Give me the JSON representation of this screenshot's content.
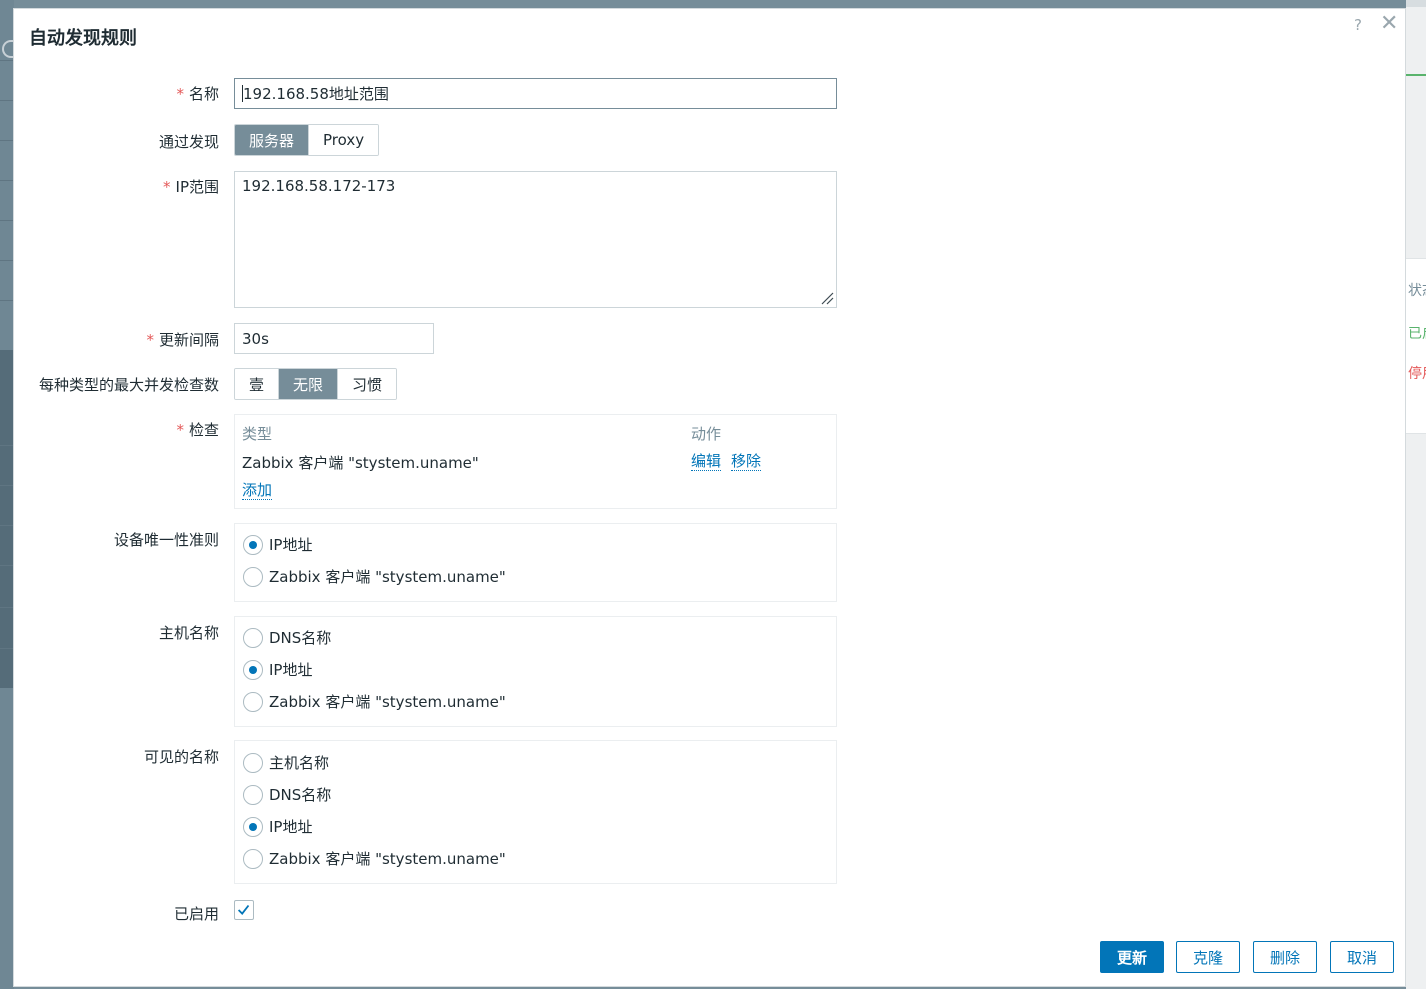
{
  "background": {
    "right_labels": [
      "状态",
      "已启用",
      "停用"
    ]
  },
  "dialog": {
    "title": "自动发现规则",
    "help_label": "?",
    "close_label": "✕"
  },
  "form": {
    "name": {
      "label": "名称",
      "required": "*",
      "value": "192.168.58地址范围"
    },
    "discovery_by": {
      "label": "通过发现",
      "options": [
        "服务器",
        "Proxy"
      ],
      "selected": "服务器"
    },
    "ip_range": {
      "label": "IP范围",
      "required": "*",
      "value": "192.168.58.172-173"
    },
    "update_interval": {
      "label": "更新间隔",
      "required": "*",
      "value": "30s"
    },
    "max_concurrent": {
      "label": "每种类型的最大并发检查数",
      "options": [
        "壹",
        "无限",
        "习惯"
      ],
      "selected": "无限"
    },
    "checks": {
      "label": "检查",
      "required": "*",
      "columns": [
        "类型",
        "动作"
      ],
      "rows": [
        {
          "type": "Zabbix 客户端 \"stystem.uname\"",
          "actions": [
            "编辑",
            "移除"
          ]
        }
      ],
      "add_label": "添加"
    },
    "uniqueness": {
      "label": "设备唯一性准则",
      "options": [
        "IP地址",
        "Zabbix 客户端 \"stystem.uname\""
      ],
      "selected": "IP地址"
    },
    "host_name": {
      "label": "主机名称",
      "options": [
        "DNS名称",
        "IP地址",
        "Zabbix 客户端 \"stystem.uname\""
      ],
      "selected": "IP地址"
    },
    "visible_name": {
      "label": "可见的名称",
      "options": [
        "主机名称",
        "DNS名称",
        "IP地址",
        "Zabbix 客户端 \"stystem.uname\""
      ],
      "selected": "IP地址"
    },
    "enabled": {
      "label": "已启用",
      "checked": true
    }
  },
  "buttons": {
    "update": "更新",
    "clone": "克隆",
    "delete": "删除",
    "cancel": "取消"
  },
  "colors": {
    "accent": "#0275b8",
    "segment_active": "#768d99",
    "required": "#e45959"
  }
}
